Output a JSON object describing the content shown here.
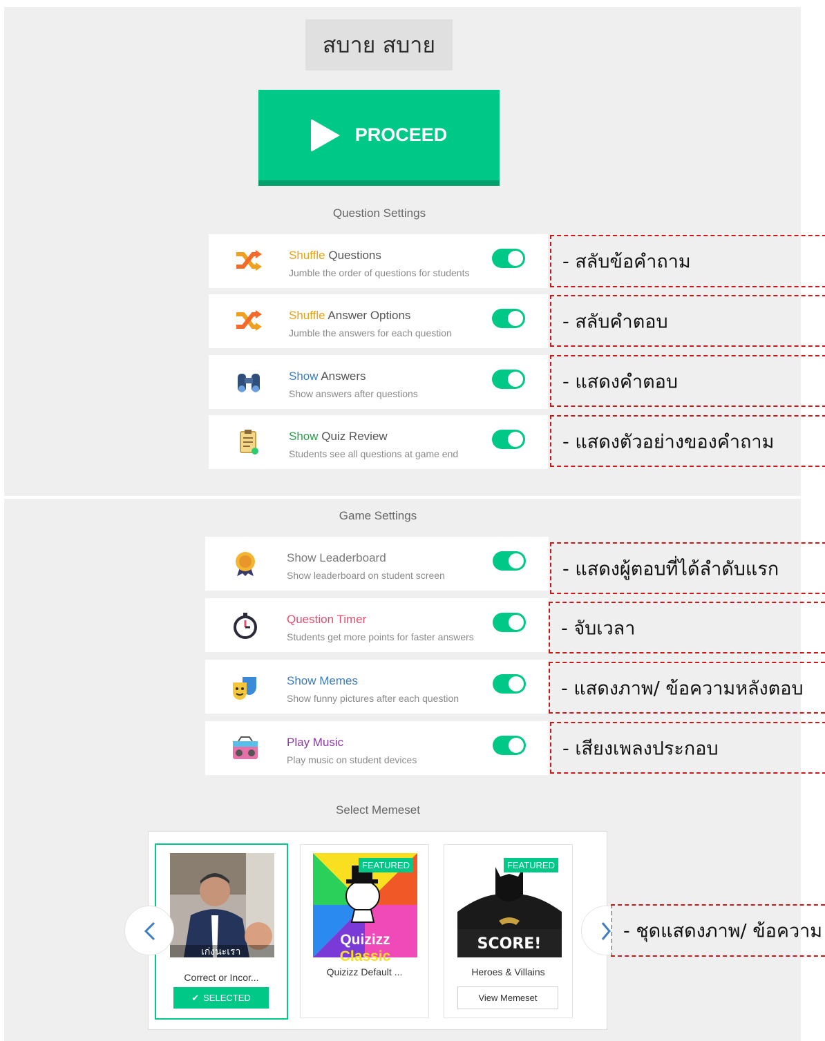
{
  "header": {
    "title": "สบาย สบาย"
  },
  "proceed": {
    "label": "PROCEED"
  },
  "question_settings": {
    "title": "Question Settings",
    "items": [
      {
        "lead": "Shuffle",
        "rest": " Questions",
        "desc": "Jumble the order of questions for students",
        "icon": "shuffle-icon",
        "lead_color": "#e6a316",
        "title_color": "#e6a316",
        "on": true
      },
      {
        "lead": "Shuffle",
        "rest": " Answer Options",
        "desc": "Jumble the answers for each question",
        "icon": "shuffle-icon",
        "lead_color": "#e6a316",
        "title_color": "#e6a316",
        "on": true
      },
      {
        "lead": "Show",
        "rest": " Answers",
        "desc": "Show answers after questions",
        "icon": "binoculars-icon",
        "lead_color": "#3d7ebf",
        "title_color": "#3d7ebf",
        "on": true
      },
      {
        "lead": "Show",
        "rest": " Quiz Review",
        "desc": "Students see all questions at game end",
        "icon": "clipboard-icon",
        "lead_color": "#2e9e4f",
        "title_color": "#2e9e4f",
        "on": true
      }
    ]
  },
  "game_settings": {
    "title": "Game Settings",
    "items": [
      {
        "title": "Show Leaderboard",
        "desc": "Show leaderboard on student screen",
        "icon": "medal-icon",
        "title_color": "#7a7a7a",
        "on": true
      },
      {
        "title": "Question Timer",
        "desc": "Students get more points for faster answers",
        "icon": "stopwatch-icon",
        "title_color": "#e0506e",
        "on": true
      },
      {
        "title": "Show Memes",
        "desc": "Show funny pictures after each question",
        "icon": "theater-masks-icon",
        "title_color": "#3d7ebf",
        "on": true
      },
      {
        "title": "Play Music",
        "desc": "Play music on student devices",
        "icon": "boombox-icon",
        "title_color": "#8a3aa0",
        "on": true
      }
    ]
  },
  "annotations": [
    "- สลับข้อคำถาม",
    "- สลับคำตอบ",
    "- แสดงคำตอบ",
    "- แสดงตัวอย่างของคำถาม",
    "- แสดงผู้ตอบที่ได้ลำดับแรก",
    "- จับเวลา",
    "- แสดงภาพ/ ข้อความหลังตอบ",
    "- เสียงเพลงประกอบ",
    "- ชุดแสดงภาพ/ ข้อความ"
  ],
  "memeset": {
    "title": "Select Memeset",
    "cards": [
      {
        "name": "Correct or Incor...",
        "caption": "เก่งนะเรา",
        "button": "SELECTED"
      },
      {
        "name": "Quizizz Default ...",
        "badge": "FEATURED",
        "caption1": "Quizizz",
        "caption2": "Classic"
      },
      {
        "name": "Heroes & Villains",
        "badge": "FEATURED",
        "caption": "SCORE!",
        "button": "View Memeset"
      }
    ]
  },
  "colors": {
    "accent": "#00c987",
    "accent_dark": "#00a06a",
    "annotation_border": "#c81818"
  }
}
